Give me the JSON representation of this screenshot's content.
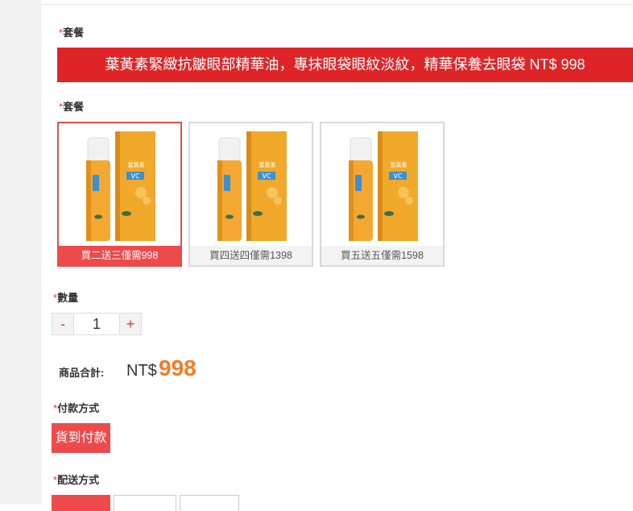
{
  "section_package_top": {
    "required_mark": "*",
    "label": "套餐"
  },
  "banner": {
    "text": "葉黃素緊緻抗皺眼部精華油，專抹眼袋眼紋淡紋，精華保養去眼袋 NT$ 998"
  },
  "section_package": {
    "required_mark": "*",
    "label": "套餐"
  },
  "packages": [
    {
      "caption": "買二送三僅需998",
      "selected": true
    },
    {
      "caption": "買四送四僅需1398",
      "selected": false
    },
    {
      "caption": "買五送五僅需1598",
      "selected": false
    }
  ],
  "product_art": {
    "bottle_text": "VC 葉黃素",
    "box_brand": "葉黃素",
    "box_badge": "VC"
  },
  "quantity": {
    "required_mark": "*",
    "label": "數量",
    "minus": "-",
    "value": "1",
    "plus": "+"
  },
  "total": {
    "label": "商品合計:",
    "currency": "NT$",
    "amount": "998"
  },
  "payment": {
    "required_mark": "*",
    "label": "付款方式",
    "option": "貨到付款"
  },
  "shipping": {
    "required_mark": "*",
    "label": "配送方式"
  },
  "colors": {
    "accent_red": "#ee4a4b",
    "banner_red": "#df2427",
    "price_orange": "#f47b22"
  }
}
